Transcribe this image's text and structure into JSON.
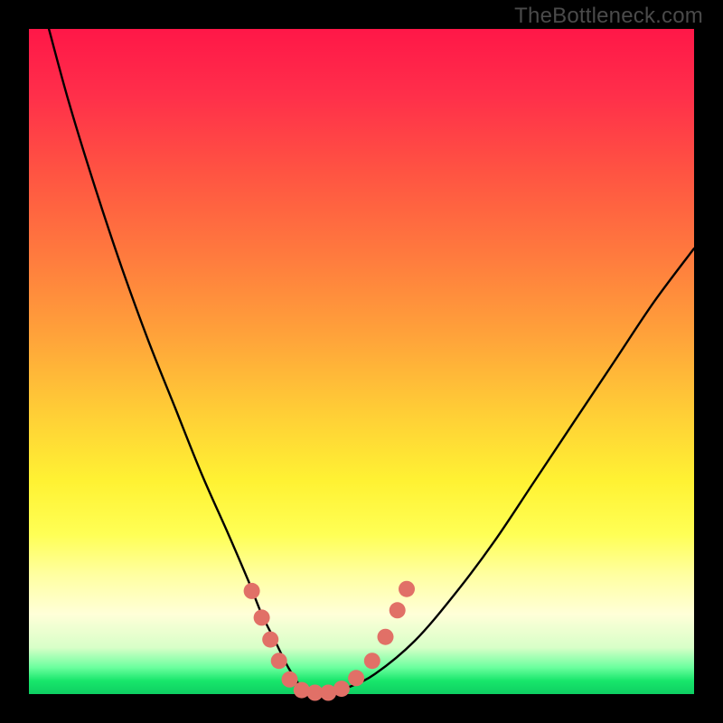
{
  "watermark": "TheBottleneck.com",
  "colors": {
    "frame": "#000000",
    "curve": "#000000",
    "marker_fill": "#e17067",
    "marker_stroke": "#c95a52"
  },
  "chart_data": {
    "type": "line",
    "title": "",
    "xlabel": "",
    "ylabel": "",
    "xlim": [
      0,
      100
    ],
    "ylim": [
      0,
      100
    ],
    "grid": false,
    "legend": false,
    "series": [
      {
        "name": "bottleneck-curve",
        "x": [
          3,
          6,
          10,
          14,
          18,
          22,
          26,
          30,
          33,
          35,
          37,
          39,
          41,
          43,
          45,
          48,
          52,
          58,
          64,
          70,
          76,
          82,
          88,
          94,
          100
        ],
        "y": [
          100,
          89,
          76,
          64,
          53,
          43,
          33,
          24,
          17,
          12,
          8,
          4,
          1,
          0,
          0,
          1,
          3,
          8,
          15,
          23,
          32,
          41,
          50,
          59,
          67
        ]
      }
    ],
    "markers": [
      {
        "x": 33.5,
        "y": 15.5
      },
      {
        "x": 35.0,
        "y": 11.5
      },
      {
        "x": 36.3,
        "y": 8.2
      },
      {
        "x": 37.6,
        "y": 5.0
      },
      {
        "x": 39.2,
        "y": 2.2
      },
      {
        "x": 41.0,
        "y": 0.6
      },
      {
        "x": 43.0,
        "y": 0.2
      },
      {
        "x": 45.0,
        "y": 0.2
      },
      {
        "x": 47.0,
        "y": 0.8
      },
      {
        "x": 49.2,
        "y": 2.4
      },
      {
        "x": 51.6,
        "y": 5.0
      },
      {
        "x": 53.6,
        "y": 8.6
      },
      {
        "x": 55.4,
        "y": 12.6
      },
      {
        "x": 56.8,
        "y": 15.8
      }
    ],
    "marker_radius_px": 9
  }
}
